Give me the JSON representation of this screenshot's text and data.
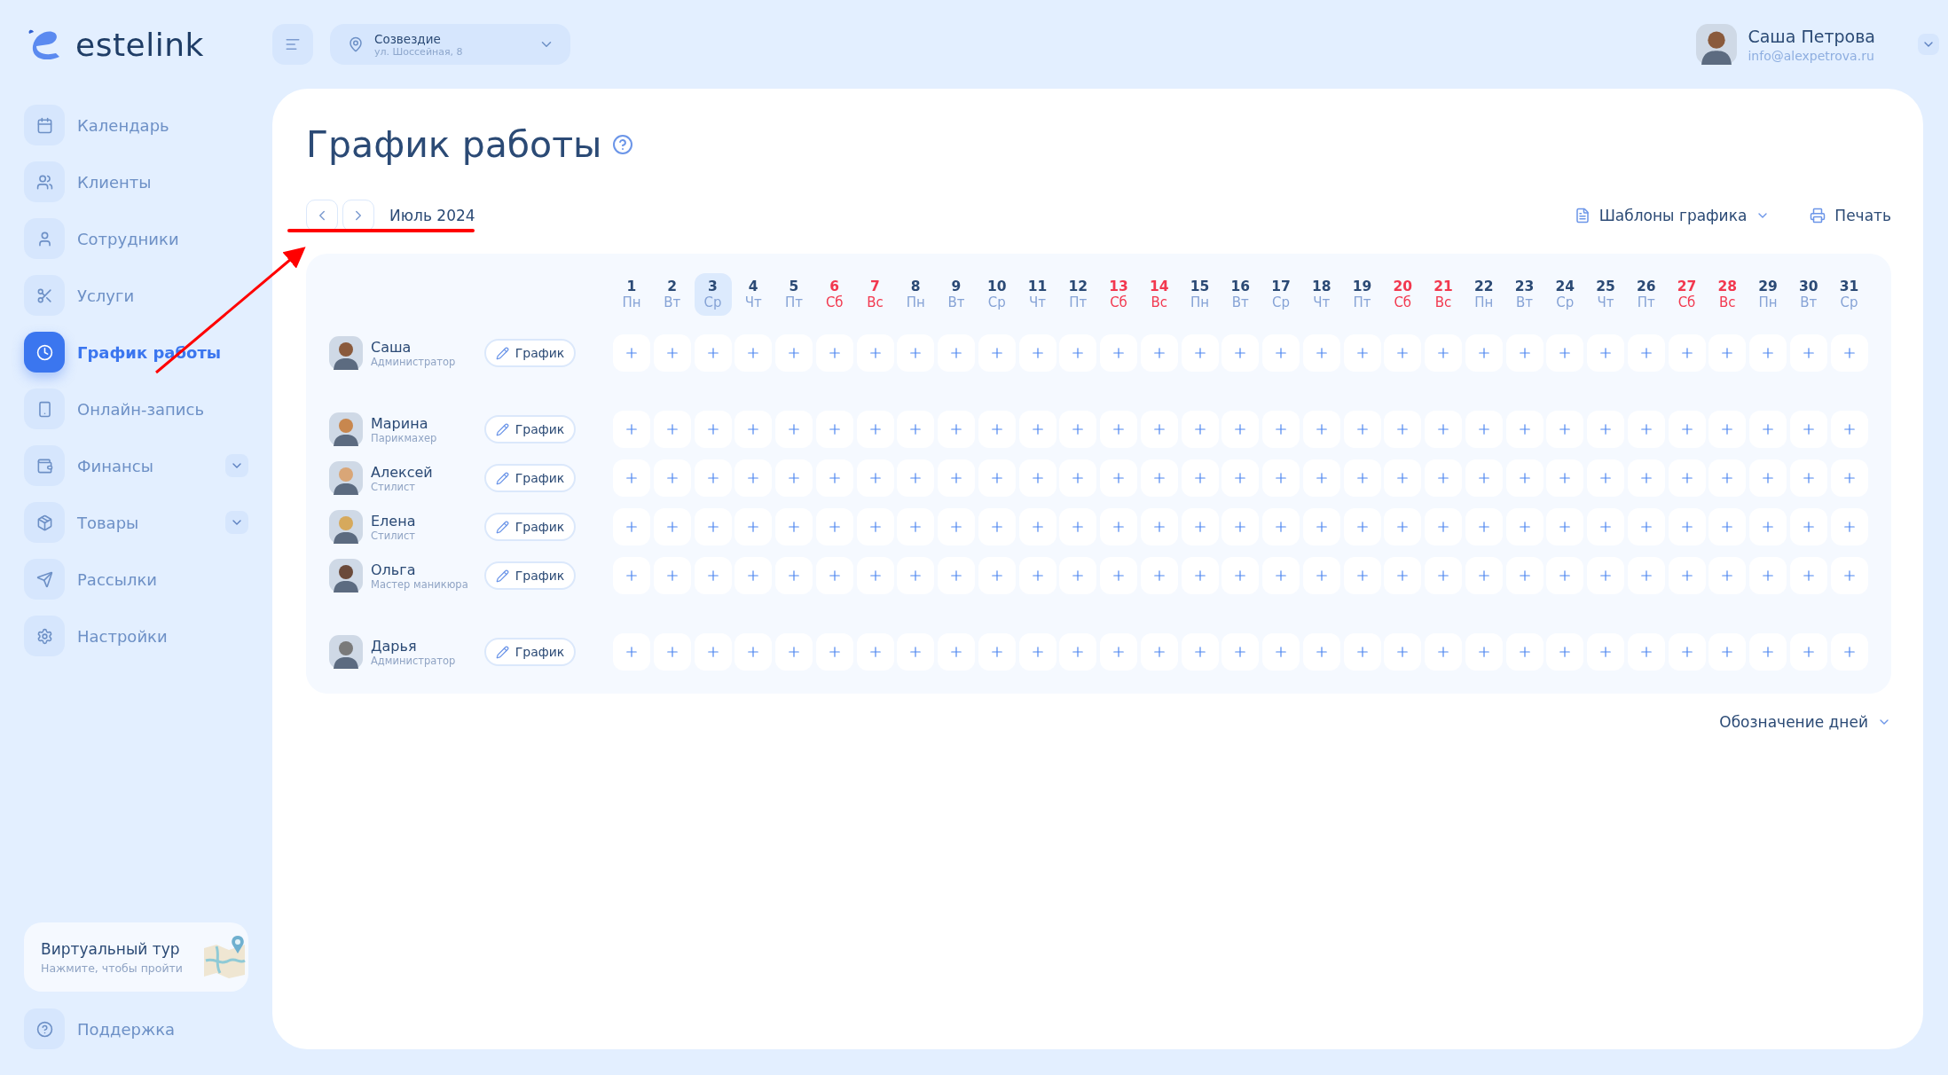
{
  "brand": {
    "name": "estelink"
  },
  "sidebar": {
    "items": [
      {
        "label": "Календарь",
        "selected": false,
        "has_submenu": false
      },
      {
        "label": "Клиенты",
        "selected": false,
        "has_submenu": false
      },
      {
        "label": "Сотрудники",
        "selected": false,
        "has_submenu": false
      },
      {
        "label": "Услуги",
        "selected": false,
        "has_submenu": false
      },
      {
        "label": "График работы",
        "selected": true,
        "has_submenu": false
      },
      {
        "label": "Онлайн-запись",
        "selected": false,
        "has_submenu": false
      },
      {
        "label": "Финансы",
        "selected": false,
        "has_submenu": true
      },
      {
        "label": "Товары",
        "selected": false,
        "has_submenu": true
      },
      {
        "label": "Рассылки",
        "selected": false,
        "has_submenu": false
      },
      {
        "label": "Настройки",
        "selected": false,
        "has_submenu": false
      }
    ],
    "tour": {
      "title": "Виртуальный тур",
      "subtitle": "Нажмите, чтобы пройти"
    },
    "support": {
      "label": "Поддержка"
    }
  },
  "location": {
    "name": "Созвездие",
    "address": "ул. Шоссейная, 8"
  },
  "user": {
    "name": "Саша Петрова",
    "email": "info@alexpetrova.ru"
  },
  "page": {
    "title": "График работы",
    "month": "Июль 2024",
    "templates": "Шаблоны графика",
    "print": "Печать",
    "legend": "Обозначение дней"
  },
  "days": [
    {
      "number": "1",
      "weekday": "Пн",
      "weekend": false,
      "selected": false
    },
    {
      "number": "2",
      "weekday": "Вт",
      "weekend": false,
      "selected": false
    },
    {
      "number": "3",
      "weekday": "Ср",
      "weekend": false,
      "selected": true
    },
    {
      "number": "4",
      "weekday": "Чт",
      "weekend": false,
      "selected": false
    },
    {
      "number": "5",
      "weekday": "Пт",
      "weekend": false,
      "selected": false
    },
    {
      "number": "6",
      "weekday": "Сб",
      "weekend": true,
      "selected": false
    },
    {
      "number": "7",
      "weekday": "Вс",
      "weekend": true,
      "selected": false
    },
    {
      "number": "8",
      "weekday": "Пн",
      "weekend": false,
      "selected": false
    },
    {
      "number": "9",
      "weekday": "Вт",
      "weekend": false,
      "selected": false
    },
    {
      "number": "10",
      "weekday": "Ср",
      "weekend": false,
      "selected": false
    },
    {
      "number": "11",
      "weekday": "Чт",
      "weekend": false,
      "selected": false
    },
    {
      "number": "12",
      "weekday": "Пт",
      "weekend": false,
      "selected": false
    },
    {
      "number": "13",
      "weekday": "Сб",
      "weekend": true,
      "selected": false
    },
    {
      "number": "14",
      "weekday": "Вс",
      "weekend": true,
      "selected": false
    },
    {
      "number": "15",
      "weekday": "Пн",
      "weekend": false,
      "selected": false
    },
    {
      "number": "16",
      "weekday": "Вт",
      "weekend": false,
      "selected": false
    },
    {
      "number": "17",
      "weekday": "Ср",
      "weekend": false,
      "selected": false
    },
    {
      "number": "18",
      "weekday": "Чт",
      "weekend": false,
      "selected": false
    },
    {
      "number": "19",
      "weekday": "Пт",
      "weekend": false,
      "selected": false
    },
    {
      "number": "20",
      "weekday": "Сб",
      "weekend": true,
      "selected": false
    },
    {
      "number": "21",
      "weekday": "Вс",
      "weekend": true,
      "selected": false
    },
    {
      "number": "22",
      "weekday": "Пн",
      "weekend": false,
      "selected": false
    },
    {
      "number": "23",
      "weekday": "Вт",
      "weekend": false,
      "selected": false
    },
    {
      "number": "24",
      "weekday": "Ср",
      "weekend": false,
      "selected": false
    },
    {
      "number": "25",
      "weekday": "Чт",
      "weekend": false,
      "selected": false
    },
    {
      "number": "26",
      "weekday": "Пт",
      "weekend": false,
      "selected": false
    },
    {
      "number": "27",
      "weekday": "Сб",
      "weekend": true,
      "selected": false
    },
    {
      "number": "28",
      "weekday": "Вс",
      "weekend": true,
      "selected": false
    },
    {
      "number": "29",
      "weekday": "Пн",
      "weekend": false,
      "selected": false
    },
    {
      "number": "30",
      "weekday": "Вт",
      "weekend": false,
      "selected": false
    },
    {
      "number": "31",
      "weekday": "Ср",
      "weekend": false,
      "selected": false
    }
  ],
  "employee_groups": [
    [
      {
        "name": "Саша",
        "role": "Администратор",
        "button": "График"
      }
    ],
    [
      {
        "name": "Марина",
        "role": "Парикмахер",
        "button": "График"
      },
      {
        "name": "Алексей",
        "role": "Стилист",
        "button": "График"
      },
      {
        "name": "Елена",
        "role": "Стилист",
        "button": "График"
      },
      {
        "name": "Ольга",
        "role": "Мастер маникюра",
        "button": "График"
      }
    ],
    [
      {
        "name": "Дарья",
        "role": "Администратор",
        "button": "График"
      }
    ]
  ]
}
